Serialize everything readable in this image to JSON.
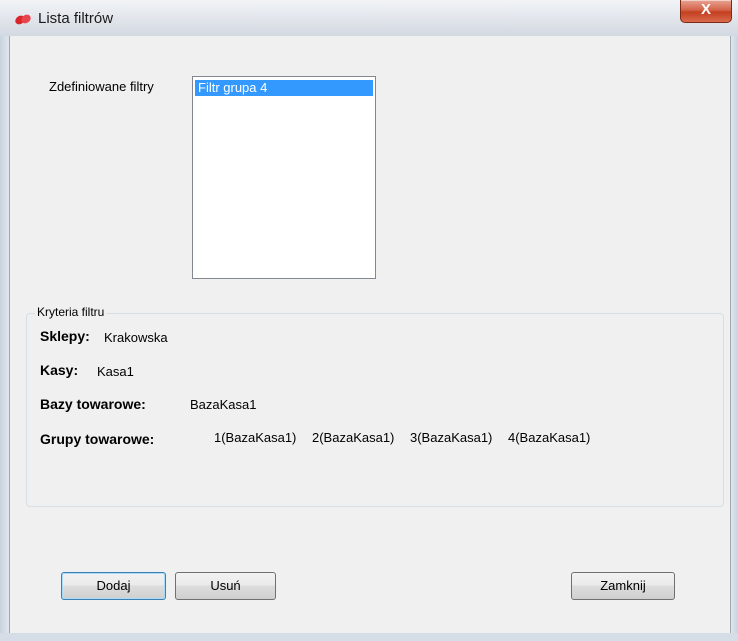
{
  "window": {
    "title": "Lista filtrów",
    "close_label": "X"
  },
  "filters": {
    "label": "Zdefiniowane filtry",
    "items": [
      "Filtr grupa 4"
    ],
    "selected_index": 0
  },
  "criteria": {
    "legend": "Kryteria filtru",
    "shops_label": "Sklepy:",
    "shops_value": "Krakowska",
    "registers_label": "Kasy:",
    "registers_value": "Kasa1",
    "databases_label": "Bazy towarowe:",
    "databases_value": "BazaKasa1",
    "groups_label": "Grupy towarowe:",
    "groups_values": [
      "1(BazaKasa1)",
      "2(BazaKasa1)",
      "3(BazaKasa1)",
      "4(BazaKasa1)"
    ]
  },
  "buttons": {
    "add": "Dodaj",
    "remove": "Usuń",
    "close": "Zamknij"
  },
  "colors": {
    "selection": "#3399ff",
    "close_button": "#c3401f"
  }
}
